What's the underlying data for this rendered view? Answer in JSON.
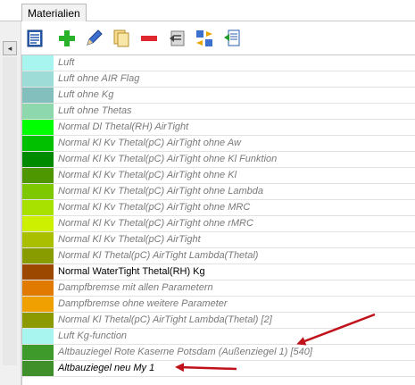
{
  "window": {
    "title": "Materialien"
  },
  "toolbar": {
    "buttons": [
      {
        "icon": "document-list-icon"
      },
      {
        "icon": "add-plus-icon"
      },
      {
        "icon": "edit-pencil-icon"
      },
      {
        "icon": "copy-pages-icon"
      },
      {
        "icon": "remove-minus-icon"
      },
      {
        "icon": "import-icon"
      },
      {
        "icon": "swap-icon"
      },
      {
        "icon": "export-icon"
      }
    ]
  },
  "materials": [
    {
      "label": "Luft",
      "color": "#a8f5f0",
      "style": "italic"
    },
    {
      "label": "Luft ohne AIR Flag",
      "color": "#9ddcd7",
      "style": "italic"
    },
    {
      "label": "Luft ohne Kg",
      "color": "#83bfbd",
      "style": "italic"
    },
    {
      "label": "Luft ohne Thetas",
      "color": "#8dd8ac",
      "style": "italic"
    },
    {
      "label": "Normal Dl  Thetal(RH) AirTight",
      "color": "#00ff00",
      "style": "italic"
    },
    {
      "label": "Normal Kl Kv Thetal(pC) AirTight ohne Aw",
      "color": "#00c000",
      "style": "italic"
    },
    {
      "label": "Normal Kl Kv Thetal(pC) AirTight ohne Kl Funktion",
      "color": "#008a00",
      "style": "italic"
    },
    {
      "label": "Normal Kl Kv Thetal(pC) AirTight ohne Kl",
      "color": "#4f9700",
      "style": "italic"
    },
    {
      "label": "Normal Kl Kv Thetal(pC) AirTight ohne Lambda",
      "color": "#7ec800",
      "style": "italic"
    },
    {
      "label": "Normal Kl Kv Thetal(pC) AirTight ohne MRC",
      "color": "#a8e000",
      "style": "italic"
    },
    {
      "label": "Normal Kl Kv Thetal(pC) AirTight ohne rMRC",
      "color": "#ccf000",
      "style": "italic"
    },
    {
      "label": "Normal Kl Kv Thetal(pC) AirTight",
      "color": "#a9bf00",
      "style": "italic"
    },
    {
      "label": "Normal Kl Thetal(pC) AirTight Lambda(Thetal)",
      "color": "#889c00",
      "style": "italic"
    },
    {
      "label": "Normal WaterTight Thetal(RH) Kg",
      "color": "#9c4800",
      "style": "normal"
    },
    {
      "label": "Dampfbremse mit allen Parametern",
      "color": "#e07a00",
      "style": "italic"
    },
    {
      "label": "Dampfbremse ohne weitere Parameter",
      "color": "#f0a000",
      "style": "italic"
    },
    {
      "label": "Normal Kl Thetal(pC) AirTight Lambda(Thetal) [2]",
      "color": "#8c9a00",
      "style": "italic"
    },
    {
      "label": "Luft Kg-function",
      "color": "#a8f5f0",
      "style": "italic"
    },
    {
      "label": "Altbauziegel Rote Kaserne Potsdam (Außenziegel 1) [540]",
      "color": "#3f9a2c",
      "style": "italic"
    },
    {
      "label": "Altbauziegel neu My 1",
      "color": "#3f8f2a",
      "style": "selected"
    }
  ]
}
